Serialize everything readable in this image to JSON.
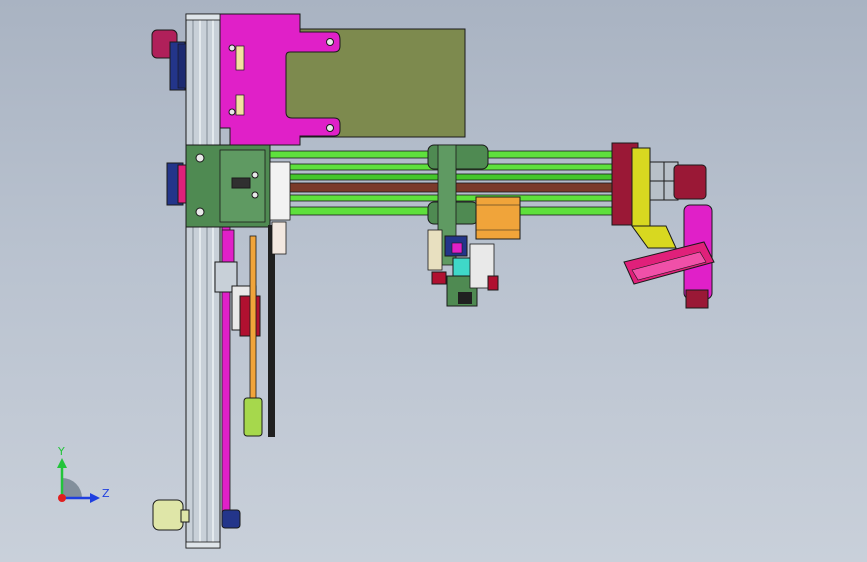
{
  "triad": {
    "y_label": "Y",
    "z_label": "Z",
    "y_color": "#22c43a",
    "z_color": "#1f3fe0",
    "x_color": "#e01f1f"
  },
  "palette": {
    "background_top": "#a9b3c2",
    "background_bottom": "#c9d0da",
    "frame": "#c8d0d8",
    "magenta": "#e020c8",
    "olive": "#7d8a4e",
    "green_rod": "#5ee03c",
    "dark_green": "#4f8a52",
    "pink_motor": "#e0207a",
    "navy": "#23358a",
    "orange": "#f0a43a",
    "teal": "#3fd8c8",
    "maroon": "#9a1836",
    "brown_rod": "#7a3a2a",
    "yellow": "#d8d820",
    "dark": "#202020"
  }
}
